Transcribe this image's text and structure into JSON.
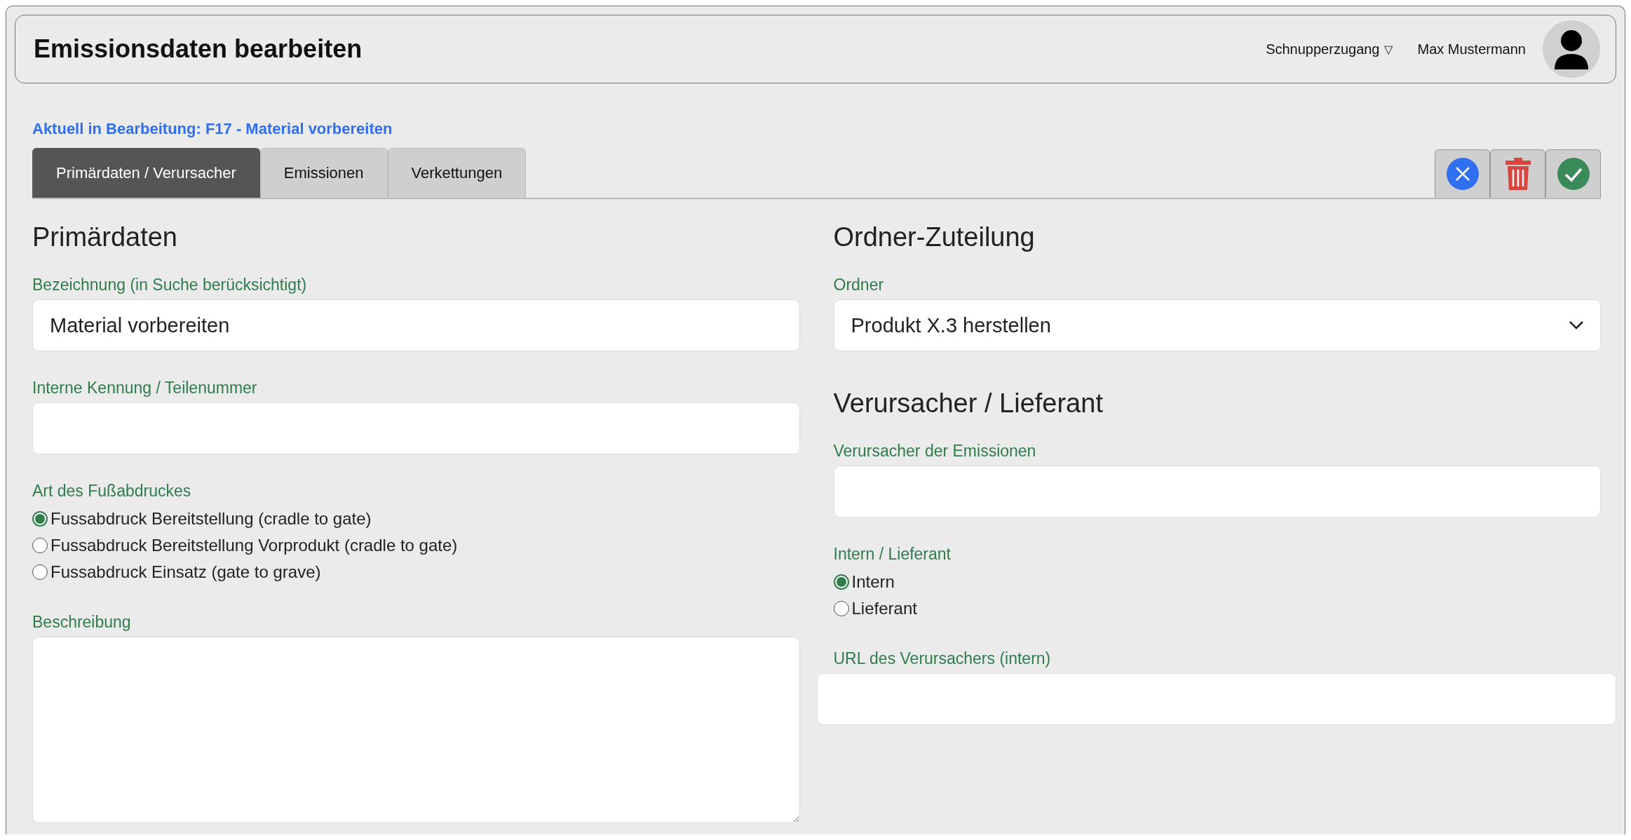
{
  "header": {
    "title": "Emissionsdaten bearbeiten",
    "account_menu": {
      "label": "Schnupperzugang",
      "caret": "▽"
    },
    "user_name": "Max Mustermann"
  },
  "context_line": "Aktuell in Bearbeitung: F17 - Material vorbereiten",
  "tabs": [
    {
      "label": "Primärdaten / Verursacher",
      "selected": true
    },
    {
      "label": "Emissionen",
      "selected": false
    },
    {
      "label": "Verkettungen",
      "selected": false
    }
  ],
  "actions": [
    {
      "kind": "cancel"
    },
    {
      "kind": "delete"
    },
    {
      "kind": "save"
    }
  ],
  "left_column": [
    {
      "kind": "heading",
      "text": "Primärdaten"
    },
    {
      "kind": "input",
      "label": "Bezeichnung (in Suche berücksichtigt)",
      "value": "Material vorbereiten"
    },
    {
      "kind": "input",
      "label": "Interne Kennung / Teilenummer"
    },
    {
      "kind": "radio",
      "label": "Art des Fußabdruckes",
      "options": [
        {
          "label": "Fussabdruck Bereitstellung (cradle to gate)",
          "selected": true
        },
        {
          "label": "Fussabdruck Bereitstellung Vorprodukt (cradle to gate)",
          "selected": false
        },
        {
          "label": "Fussabdruck Einsatz (gate to grave)",
          "selected": false
        }
      ]
    },
    {
      "kind": "textarea",
      "label": "Beschreibung"
    }
  ],
  "right_column": [
    {
      "kind": "heading",
      "text": "Ordner-Zuteilung"
    },
    {
      "kind": "select",
      "label": "Ordner",
      "value": "Produkt X.3 herstellen"
    },
    {
      "kind": "heading",
      "text": "Verursacher / Lieferant"
    },
    {
      "kind": "input",
      "label": "Verursacher der Emissionen"
    },
    {
      "kind": "radio",
      "label": "Intern / Lieferant",
      "options": [
        {
          "label": "Intern",
          "selected": true
        },
        {
          "label": "Lieferant",
          "selected": false
        }
      ]
    },
    {
      "kind": "wide_input",
      "label": "URL des Verursachers (intern)"
    }
  ]
}
